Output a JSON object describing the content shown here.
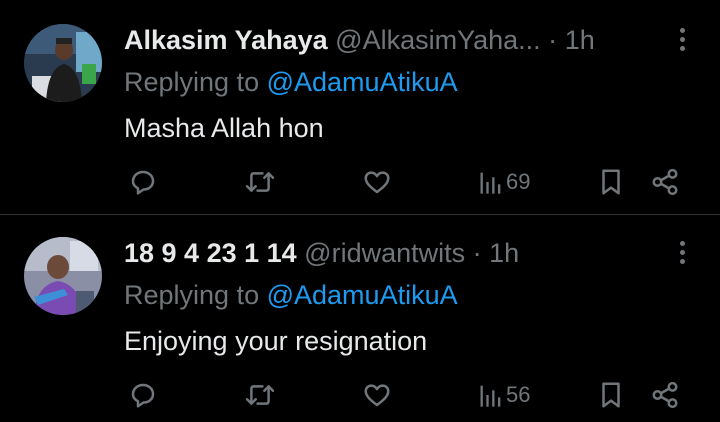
{
  "colors": {
    "background": "#000000",
    "text_primary": "#e7e9ea",
    "text_secondary": "#71767b",
    "accent": "#1d9bf0",
    "divider": "#2f3336"
  },
  "tweets": [
    {
      "display_name": "Alkasim Yahaya",
      "handle": "@AlkasimYaha...",
      "separator": "·",
      "time": "1h",
      "reply_prefix": "Replying to",
      "reply_target": "@AdamuAtikuA",
      "text": "Masha Allah hon",
      "views": "69",
      "icons": [
        "reply-icon",
        "repost-icon",
        "like-icon",
        "views-icon",
        "bookmark-icon",
        "share-icon",
        "more-icon"
      ]
    },
    {
      "display_name": "18 9 4 23 1 14",
      "handle": "@ridwantwits",
      "separator": "·",
      "time": "1h",
      "reply_prefix": "Replying to",
      "reply_target": "@AdamuAtikuA",
      "text": "Enjoying your resignation",
      "views": "56",
      "icons": [
        "reply-icon",
        "repost-icon",
        "like-icon",
        "views-icon",
        "bookmark-icon",
        "share-icon",
        "more-icon"
      ]
    }
  ]
}
